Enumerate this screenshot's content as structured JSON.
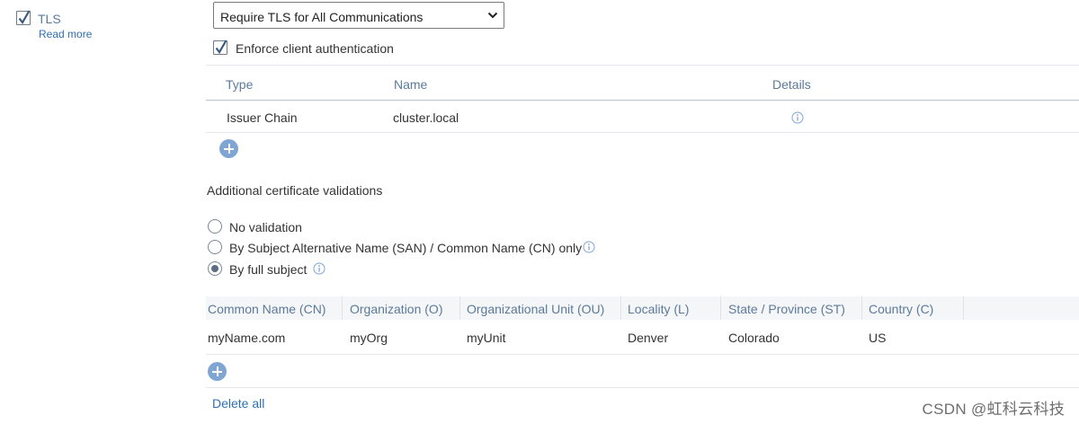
{
  "tls": {
    "label": "TLS",
    "checked": true,
    "read_more": "Read more"
  },
  "tls_mode": {
    "selected": "Require TLS for All Communications"
  },
  "client_auth": {
    "label": "Enforce client authentication",
    "checked": true
  },
  "trust_table": {
    "headers": [
      "Type",
      "Name",
      "Details"
    ],
    "rows": [
      {
        "type": "Issuer Chain",
        "name": "cluster.local",
        "details_icon": "info-icon"
      }
    ]
  },
  "validations": {
    "title": "Additional certificate validations",
    "options": [
      {
        "label": "No validation",
        "selected": false,
        "info": false
      },
      {
        "label": "By Subject Alternative Name (SAN) / Common Name (CN) only",
        "selected": false,
        "info": true
      },
      {
        "label": "By full subject",
        "selected": true,
        "info": true
      }
    ]
  },
  "subject_table": {
    "headers": [
      "Common Name (CN)",
      "Organization (O)",
      "Organizational Unit (OU)",
      "Locality (L)",
      "State / Province (ST)",
      "Country (C)"
    ],
    "rows": [
      [
        "myName.com",
        "myOrg",
        "myUnit",
        "Denver",
        "Colorado",
        "US"
      ]
    ]
  },
  "delete_all": "Delete all",
  "watermark": "CSDN @虹科云科技",
  "colors": {
    "accent": "#2f6fb1",
    "header_text": "#5b7a9b",
    "add_button": "#7fa6d3"
  }
}
